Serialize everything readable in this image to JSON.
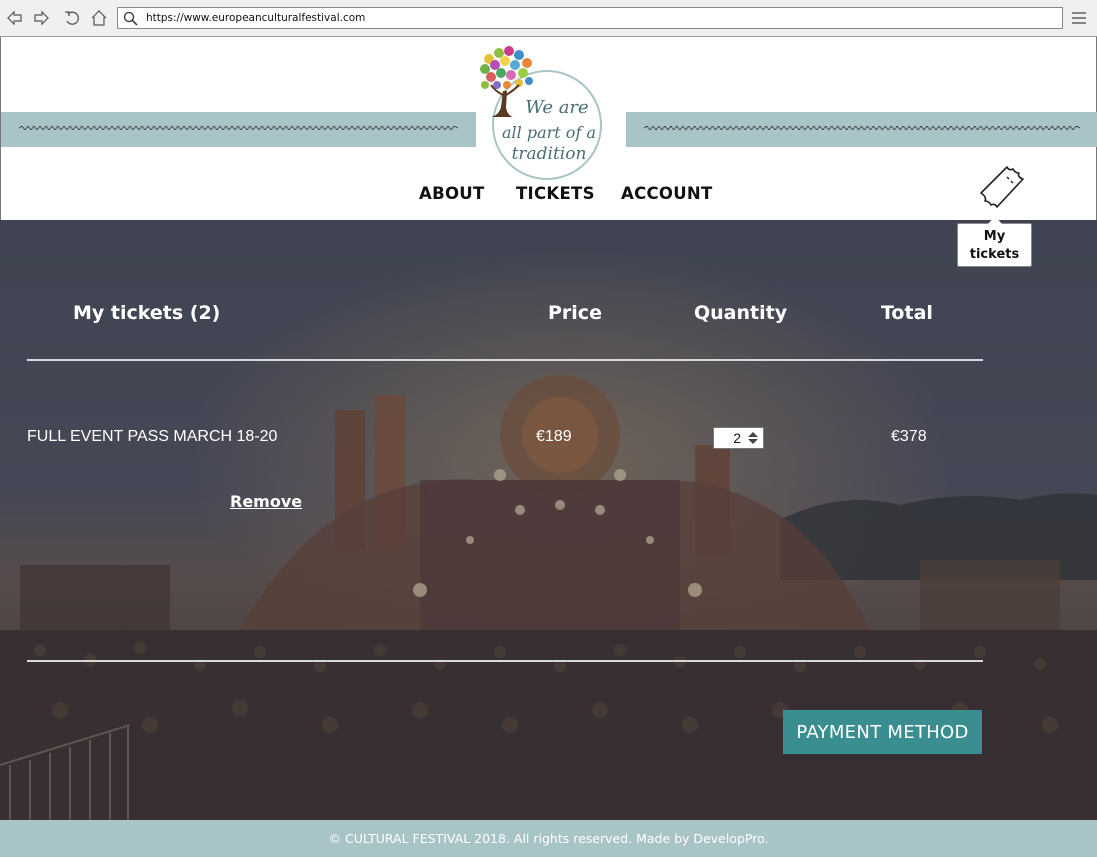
{
  "browser": {
    "url": "https://www.europeanculturalfestival.com",
    "nav_icons": [
      "back-icon",
      "forward-icon",
      "reload-icon",
      "home-icon",
      "search-icon",
      "hamburger-menu-icon"
    ]
  },
  "header": {
    "logo_text": "We are all part of a tradition",
    "nav": {
      "about": "ABOUT",
      "tickets": "TICKETS",
      "account": "ACCOUNT"
    },
    "ticket_icon": "ticket-icon",
    "tooltip": "My tickets"
  },
  "cart": {
    "heading": "My tickets (2)",
    "col_price": "Price",
    "col_quantity": "Quantity",
    "col_total": "Total",
    "items": [
      {
        "name": "FULL EVENT PASS MARCH 18-20",
        "price": "€189",
        "quantity": "2",
        "total": "€378",
        "remove_label": "Remove"
      }
    ],
    "payment_button": "PAYMENT METHOD"
  },
  "footer": {
    "text": "© CULTURAL FESTIVAL 2018. All rights reserved. Made by DevelopPro."
  },
  "colors": {
    "band": "#a9c4c6",
    "button": "#3a8e8f",
    "overlay": "#3f4450"
  }
}
